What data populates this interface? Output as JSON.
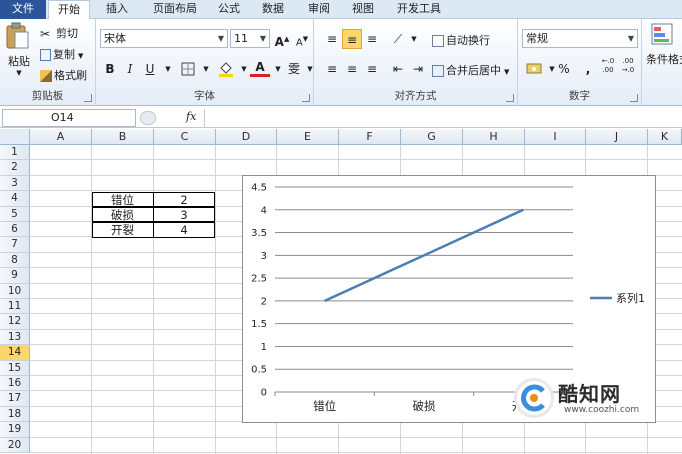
{
  "tabs": [
    "文件",
    "开始",
    "插入",
    "页面布局",
    "公式",
    "数据",
    "审阅",
    "视图",
    "开发工具"
  ],
  "clipboard": {
    "paste": "粘贴",
    "cut": "剪切",
    "copy": "复制",
    "format_painter": "格式刷",
    "group_label": "剪贴板"
  },
  "font": {
    "name": "宋体",
    "size": "11",
    "group_label": "字体",
    "bold": "B",
    "italic": "I",
    "underline": "U",
    "font_color_glyph": "A",
    "wen_glyph": "雯"
  },
  "alignment": {
    "wrap": "自动换行",
    "merge": "合并后居中",
    "group_label": "对齐方式"
  },
  "number": {
    "format": "常规",
    "group_label": "数字",
    "percent": "%",
    "comma": ",",
    "inc_dec": "←.0\n.00",
    "dec_dec": ".00\n→.0"
  },
  "styles": {
    "conditional": "条件格式"
  },
  "formula_bar": {
    "name_box": "O14",
    "fx": "fx",
    "value": ""
  },
  "columns": [
    "A",
    "B",
    "C",
    "D",
    "E",
    "F",
    "G",
    "H",
    "I",
    "J",
    "K"
  ],
  "rows": [
    "1",
    "2",
    "3",
    "4",
    "5",
    "6",
    "7",
    "8",
    "9",
    "10",
    "11",
    "12",
    "13",
    "14",
    "15",
    "16",
    "17",
    "18",
    "19",
    "20"
  ],
  "active_row": "14",
  "table": [
    {
      "label": "错位",
      "value": "2"
    },
    {
      "label": "破损",
      "value": "3"
    },
    {
      "label": "开裂",
      "value": "4"
    }
  ],
  "chart_data": {
    "type": "line",
    "categories": [
      "错位",
      "破损",
      "开裂"
    ],
    "series": [
      {
        "name": "系列1",
        "values": [
          2,
          3,
          4
        ],
        "color": "#4a7eb5"
      }
    ],
    "y_ticks": [
      "0",
      "0.5",
      "1",
      "1.5",
      "2",
      "2.5",
      "3",
      "3.5",
      "4",
      "4.5"
    ],
    "ylim": [
      0,
      4.5
    ],
    "grid": true,
    "legend": "right"
  },
  "watermark": {
    "title": "酷知网",
    "url": "www.coozhi.com"
  }
}
